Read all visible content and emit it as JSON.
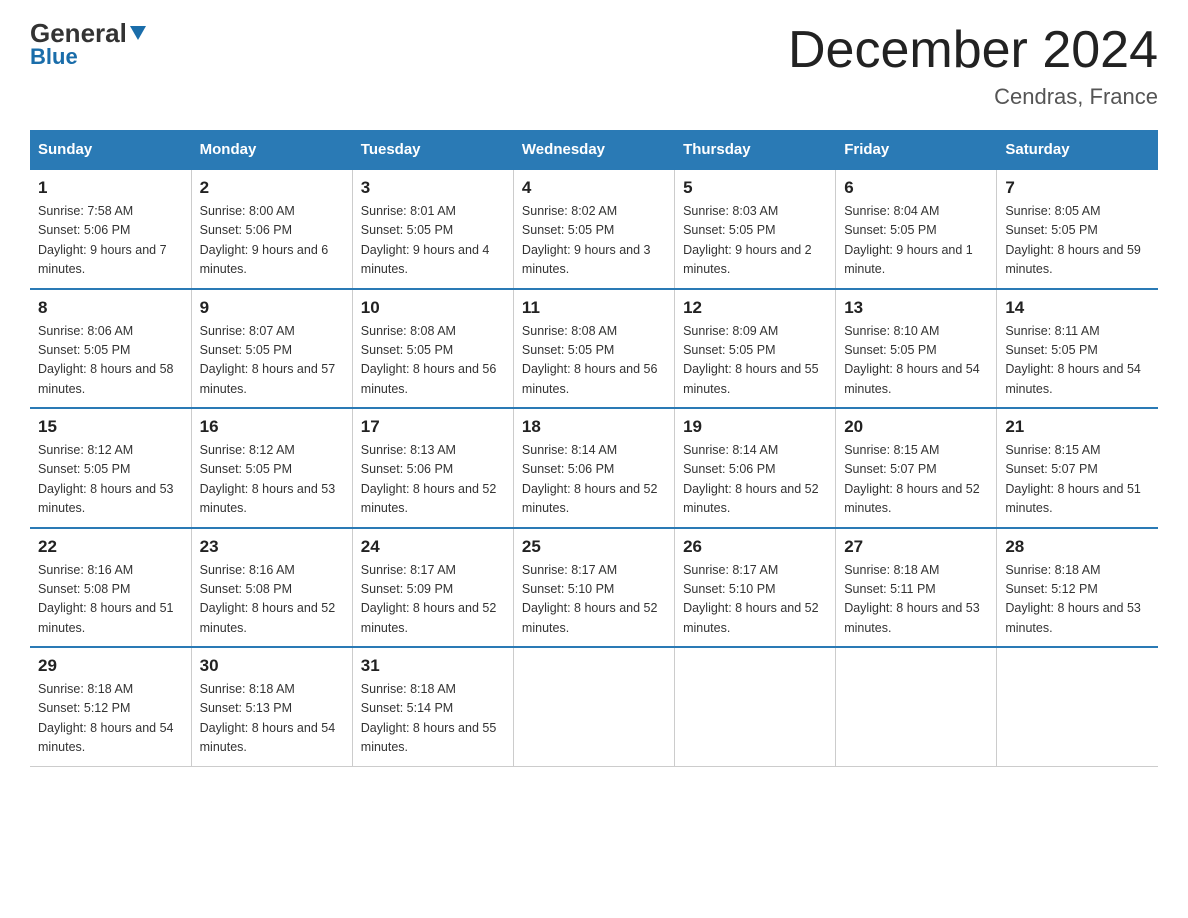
{
  "logo": {
    "general": "General",
    "blue": "Blue"
  },
  "title": "December 2024",
  "location": "Cendras, France",
  "days_of_week": [
    "Sunday",
    "Monday",
    "Tuesday",
    "Wednesday",
    "Thursday",
    "Friday",
    "Saturday"
  ],
  "weeks": [
    [
      {
        "day": "1",
        "sunrise": "7:58 AM",
        "sunset": "5:06 PM",
        "daylight": "9 hours and 7 minutes."
      },
      {
        "day": "2",
        "sunrise": "8:00 AM",
        "sunset": "5:06 PM",
        "daylight": "9 hours and 6 minutes."
      },
      {
        "day": "3",
        "sunrise": "8:01 AM",
        "sunset": "5:05 PM",
        "daylight": "9 hours and 4 minutes."
      },
      {
        "day": "4",
        "sunrise": "8:02 AM",
        "sunset": "5:05 PM",
        "daylight": "9 hours and 3 minutes."
      },
      {
        "day": "5",
        "sunrise": "8:03 AM",
        "sunset": "5:05 PM",
        "daylight": "9 hours and 2 minutes."
      },
      {
        "day": "6",
        "sunrise": "8:04 AM",
        "sunset": "5:05 PM",
        "daylight": "9 hours and 1 minute."
      },
      {
        "day": "7",
        "sunrise": "8:05 AM",
        "sunset": "5:05 PM",
        "daylight": "8 hours and 59 minutes."
      }
    ],
    [
      {
        "day": "8",
        "sunrise": "8:06 AM",
        "sunset": "5:05 PM",
        "daylight": "8 hours and 58 minutes."
      },
      {
        "day": "9",
        "sunrise": "8:07 AM",
        "sunset": "5:05 PM",
        "daylight": "8 hours and 57 minutes."
      },
      {
        "day": "10",
        "sunrise": "8:08 AM",
        "sunset": "5:05 PM",
        "daylight": "8 hours and 56 minutes."
      },
      {
        "day": "11",
        "sunrise": "8:08 AM",
        "sunset": "5:05 PM",
        "daylight": "8 hours and 56 minutes."
      },
      {
        "day": "12",
        "sunrise": "8:09 AM",
        "sunset": "5:05 PM",
        "daylight": "8 hours and 55 minutes."
      },
      {
        "day": "13",
        "sunrise": "8:10 AM",
        "sunset": "5:05 PM",
        "daylight": "8 hours and 54 minutes."
      },
      {
        "day": "14",
        "sunrise": "8:11 AM",
        "sunset": "5:05 PM",
        "daylight": "8 hours and 54 minutes."
      }
    ],
    [
      {
        "day": "15",
        "sunrise": "8:12 AM",
        "sunset": "5:05 PM",
        "daylight": "8 hours and 53 minutes."
      },
      {
        "day": "16",
        "sunrise": "8:12 AM",
        "sunset": "5:05 PM",
        "daylight": "8 hours and 53 minutes."
      },
      {
        "day": "17",
        "sunrise": "8:13 AM",
        "sunset": "5:06 PM",
        "daylight": "8 hours and 52 minutes."
      },
      {
        "day": "18",
        "sunrise": "8:14 AM",
        "sunset": "5:06 PM",
        "daylight": "8 hours and 52 minutes."
      },
      {
        "day": "19",
        "sunrise": "8:14 AM",
        "sunset": "5:06 PM",
        "daylight": "8 hours and 52 minutes."
      },
      {
        "day": "20",
        "sunrise": "8:15 AM",
        "sunset": "5:07 PM",
        "daylight": "8 hours and 52 minutes."
      },
      {
        "day": "21",
        "sunrise": "8:15 AM",
        "sunset": "5:07 PM",
        "daylight": "8 hours and 51 minutes."
      }
    ],
    [
      {
        "day": "22",
        "sunrise": "8:16 AM",
        "sunset": "5:08 PM",
        "daylight": "8 hours and 51 minutes."
      },
      {
        "day": "23",
        "sunrise": "8:16 AM",
        "sunset": "5:08 PM",
        "daylight": "8 hours and 52 minutes."
      },
      {
        "day": "24",
        "sunrise": "8:17 AM",
        "sunset": "5:09 PM",
        "daylight": "8 hours and 52 minutes."
      },
      {
        "day": "25",
        "sunrise": "8:17 AM",
        "sunset": "5:10 PM",
        "daylight": "8 hours and 52 minutes."
      },
      {
        "day": "26",
        "sunrise": "8:17 AM",
        "sunset": "5:10 PM",
        "daylight": "8 hours and 52 minutes."
      },
      {
        "day": "27",
        "sunrise": "8:18 AM",
        "sunset": "5:11 PM",
        "daylight": "8 hours and 53 minutes."
      },
      {
        "day": "28",
        "sunrise": "8:18 AM",
        "sunset": "5:12 PM",
        "daylight": "8 hours and 53 minutes."
      }
    ],
    [
      {
        "day": "29",
        "sunrise": "8:18 AM",
        "sunset": "5:12 PM",
        "daylight": "8 hours and 54 minutes."
      },
      {
        "day": "30",
        "sunrise": "8:18 AM",
        "sunset": "5:13 PM",
        "daylight": "8 hours and 54 minutes."
      },
      {
        "day": "31",
        "sunrise": "8:18 AM",
        "sunset": "5:14 PM",
        "daylight": "8 hours and 55 minutes."
      },
      null,
      null,
      null,
      null
    ]
  ],
  "labels": {
    "sunrise": "Sunrise:",
    "sunset": "Sunset:",
    "daylight": "Daylight:"
  }
}
